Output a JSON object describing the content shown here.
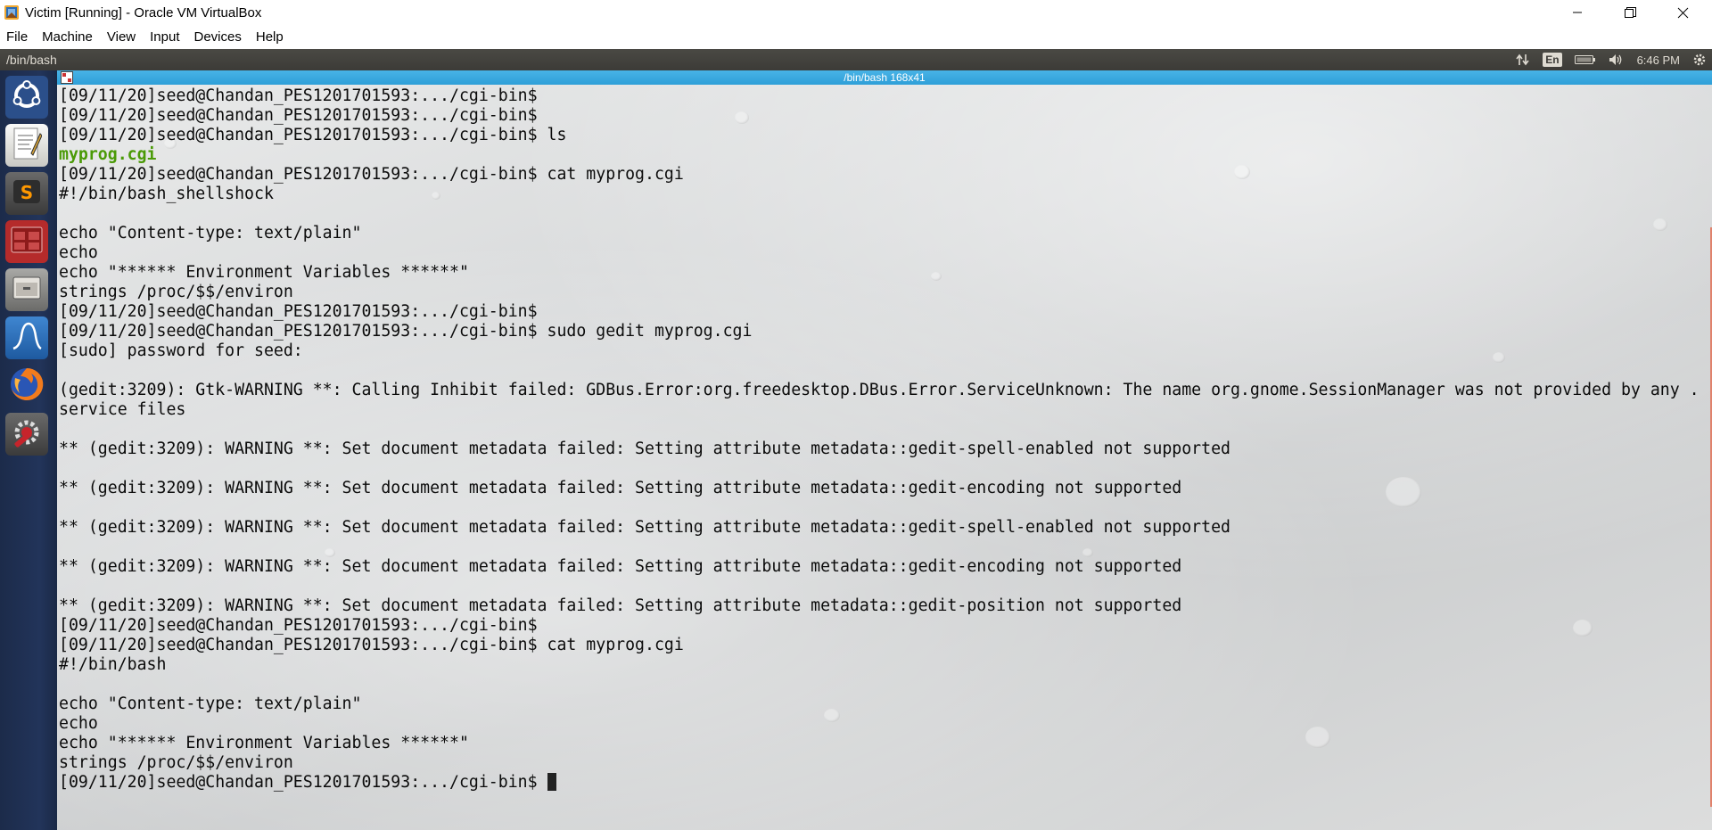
{
  "window": {
    "title": "Victim [Running] - Oracle VM VirtualBox",
    "icon": "virtualbox-icon",
    "controls": [
      "minimize-icon",
      "restore-icon",
      "close-icon"
    ]
  },
  "menubar": {
    "items": [
      "File",
      "Machine",
      "View",
      "Input",
      "Devices",
      "Help"
    ]
  },
  "panel": {
    "title": "/bin/bash",
    "keyboard_layout": "En",
    "clock": "6:46 PM",
    "icons": [
      "network-arrows-icon",
      "keyboard-icon",
      "battery-icon",
      "volume-icon",
      "settings-gear-icon"
    ]
  },
  "launcher": {
    "items": [
      {
        "name": "ubuntu-dash",
        "icon": "ubuntu-logo-icon",
        "color": "#2b4f8a"
      },
      {
        "name": "text-editor",
        "icon": "text-editor-icon",
        "color": "#d8d8d4"
      },
      {
        "name": "sublime-text",
        "icon": "sublime-text-icon",
        "color": "#4d4d4d"
      },
      {
        "name": "terminal",
        "icon": "terminal-icon",
        "color": "#b52b2b"
      },
      {
        "name": "file-manager",
        "icon": "file-manager-icon",
        "color": "#8e8e8c"
      },
      {
        "name": "wireshark",
        "icon": "wireshark-icon",
        "color": "#2b6cb6"
      },
      {
        "name": "firefox",
        "icon": "firefox-icon",
        "color": "#e66000"
      },
      {
        "name": "system-settings",
        "icon": "system-settings-icon",
        "color": "#c6242b"
      }
    ]
  },
  "terminal": {
    "title": "/bin/bash 168x41",
    "lines": [
      {
        "text": "[09/11/20]seed@Chandan_PES1201701593:.../cgi-bin$ ",
        "style": "normal"
      },
      {
        "text": "[09/11/20]seed@Chandan_PES1201701593:.../cgi-bin$ ",
        "style": "normal"
      },
      {
        "text": "[09/11/20]seed@Chandan_PES1201701593:.../cgi-bin$ ls",
        "style": "normal"
      },
      {
        "text": "myprog.cgi",
        "style": "green"
      },
      {
        "text": "[09/11/20]seed@Chandan_PES1201701593:.../cgi-bin$ cat myprog.cgi",
        "style": "normal"
      },
      {
        "text": "#!/bin/bash_shellshock",
        "style": "normal"
      },
      {
        "text": "",
        "style": "normal"
      },
      {
        "text": "echo \"Content-type: text/plain\"",
        "style": "normal"
      },
      {
        "text": "echo",
        "style": "normal"
      },
      {
        "text": "echo \"****** Environment Variables ******\"",
        "style": "normal"
      },
      {
        "text": "strings /proc/$$/environ",
        "style": "normal"
      },
      {
        "text": "[09/11/20]seed@Chandan_PES1201701593:.../cgi-bin$ ",
        "style": "normal"
      },
      {
        "text": "[09/11/20]seed@Chandan_PES1201701593:.../cgi-bin$ sudo gedit myprog.cgi",
        "style": "normal"
      },
      {
        "text": "[sudo] password for seed: ",
        "style": "normal"
      },
      {
        "text": "",
        "style": "normal"
      },
      {
        "text": "(gedit:3209): Gtk-WARNING **: Calling Inhibit failed: GDBus.Error:org.freedesktop.DBus.Error.ServiceUnknown: The name org.gnome.SessionManager was not provided by any .",
        "style": "normal"
      },
      {
        "text": "service files",
        "style": "normal"
      },
      {
        "text": "",
        "style": "normal"
      },
      {
        "text": "** (gedit:3209): WARNING **: Set document metadata failed: Setting attribute metadata::gedit-spell-enabled not supported",
        "style": "normal"
      },
      {
        "text": "",
        "style": "normal"
      },
      {
        "text": "** (gedit:3209): WARNING **: Set document metadata failed: Setting attribute metadata::gedit-encoding not supported",
        "style": "normal"
      },
      {
        "text": "",
        "style": "normal"
      },
      {
        "text": "** (gedit:3209): WARNING **: Set document metadata failed: Setting attribute metadata::gedit-spell-enabled not supported",
        "style": "normal"
      },
      {
        "text": "",
        "style": "normal"
      },
      {
        "text": "** (gedit:3209): WARNING **: Set document metadata failed: Setting attribute metadata::gedit-encoding not supported",
        "style": "normal"
      },
      {
        "text": "",
        "style": "normal"
      },
      {
        "text": "** (gedit:3209): WARNING **: Set document metadata failed: Setting attribute metadata::gedit-position not supported",
        "style": "normal"
      },
      {
        "text": "[09/11/20]seed@Chandan_PES1201701593:.../cgi-bin$ ",
        "style": "normal"
      },
      {
        "text": "[09/11/20]seed@Chandan_PES1201701593:.../cgi-bin$ cat myprog.cgi",
        "style": "normal"
      },
      {
        "text": "#!/bin/bash",
        "style": "normal"
      },
      {
        "text": "",
        "style": "normal"
      },
      {
        "text": "echo \"Content-type: text/plain\"",
        "style": "normal"
      },
      {
        "text": "echo",
        "style": "normal"
      },
      {
        "text": "echo \"****** Environment Variables ******\"",
        "style": "normal"
      },
      {
        "text": "strings /proc/$$/environ",
        "style": "normal"
      },
      {
        "text": "[09/11/20]seed@Chandan_PES1201701593:.../cgi-bin$ ",
        "style": "prompt-cursor"
      }
    ]
  }
}
